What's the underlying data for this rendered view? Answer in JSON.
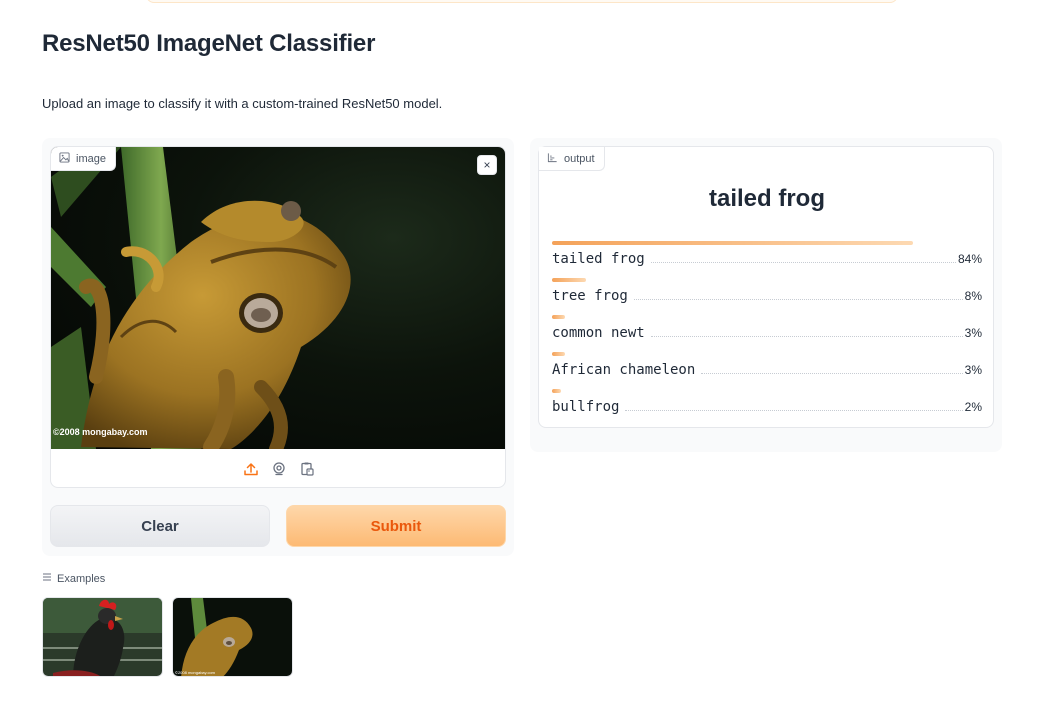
{
  "page": {
    "title": "ResNet50 ImageNet Classifier",
    "description": "Upload an image to classify it with a custom-trained ResNet50 model."
  },
  "input": {
    "label": "image",
    "label_icon": "image-icon",
    "watermark": "©2008 mongabay.com",
    "close_symbol": "×",
    "source_icons": [
      "upload-icon",
      "webcam-icon",
      "clipboard-icon"
    ]
  },
  "buttons": {
    "clear": "Clear",
    "submit": "Submit"
  },
  "output": {
    "label": "output",
    "label_icon": "chart-icon",
    "top_prediction": "tailed frog",
    "confidences": [
      {
        "label": "tailed frog",
        "value": "84%",
        "fraction": 0.84
      },
      {
        "label": "tree frog",
        "value": "8%",
        "fraction": 0.08
      },
      {
        "label": "common newt",
        "value": "3%",
        "fraction": 0.03
      },
      {
        "label": "African chameleon",
        "value": "3%",
        "fraction": 0.03
      },
      {
        "label": "bullfrog",
        "value": "2%",
        "fraction": 0.02
      }
    ]
  },
  "examples": {
    "label": "Examples",
    "items": [
      "rooster",
      "frog"
    ]
  },
  "colors": {
    "accent": "#f97316",
    "submit_text": "#ea580c",
    "bar_start": "#f4a259",
    "bar_end": "#fdd9b2"
  }
}
